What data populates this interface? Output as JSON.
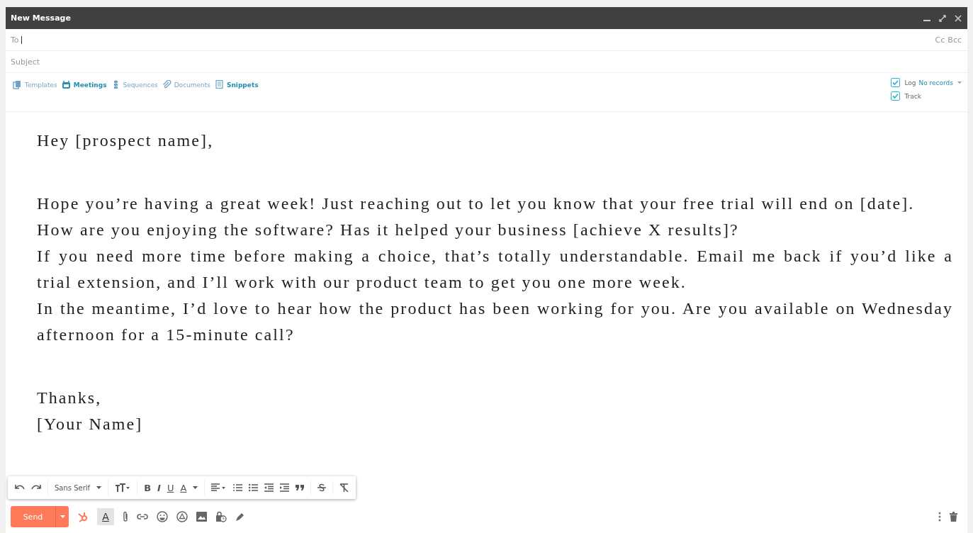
{
  "window": {
    "title": "New Message"
  },
  "to": {
    "label": "To",
    "cc": "Cc",
    "bcc": "Bcc"
  },
  "subject": {
    "placeholder": "Subject"
  },
  "tools": [
    {
      "label": "Templates",
      "active": false
    },
    {
      "label": "Meetings",
      "active": true
    },
    {
      "label": "Sequences",
      "active": false
    },
    {
      "label": "Documents",
      "active": false
    },
    {
      "label": "Snippets",
      "active": true
    }
  ],
  "options": [
    {
      "label": "Log",
      "checked": true,
      "link": "No records"
    },
    {
      "label": "Track",
      "checked": true
    }
  ],
  "body": [
    [
      "Hey [prospect name],"
    ],
    [
      "Hope you’re having a great week! Just reaching out to let you know that your free trial will end on [date].",
      "How are you enjoying the software? Has it helped your business [achieve X results]?",
      "If you need more time before making a choice, that’s totally understandable. Email me back if you’d like a trial extension, and I’ll work with our product team to get you one more week.",
      "In the meantime, I’d love to hear how the product has been working for you. Are you available on Wednesday afternoon for a 15-minute call?"
    ],
    [
      "Thanks,",
      "[Your Name]"
    ]
  ],
  "format_toolbar": {
    "font": "Sans Serif",
    "bold": "B",
    "italic": "I",
    "underline": "U",
    "text_color": "A"
  },
  "bottom_bar": {
    "send": "Send",
    "formatting_toggle": {
      "label": "A",
      "on": true
    }
  }
}
